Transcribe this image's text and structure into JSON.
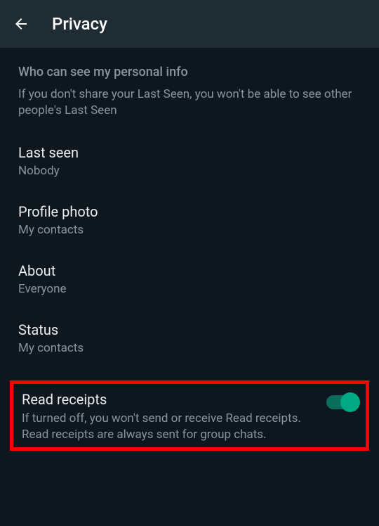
{
  "header": {
    "title": "Privacy"
  },
  "section": {
    "header": "Who can see my personal info",
    "subtext": "If you don't share your Last Seen, you won't be able to see other people's Last Seen"
  },
  "settings": {
    "lastSeen": {
      "title": "Last seen",
      "value": "Nobody"
    },
    "profilePhoto": {
      "title": "Profile photo",
      "value": "My contacts"
    },
    "about": {
      "title": "About",
      "value": "Everyone"
    },
    "status": {
      "title": "Status",
      "value": "My contacts"
    }
  },
  "readReceipts": {
    "title": "Read receipts",
    "description": "If turned off, you won't send or receive Read receipts. Read receipts are always sent for group chats.",
    "enabled": true
  }
}
